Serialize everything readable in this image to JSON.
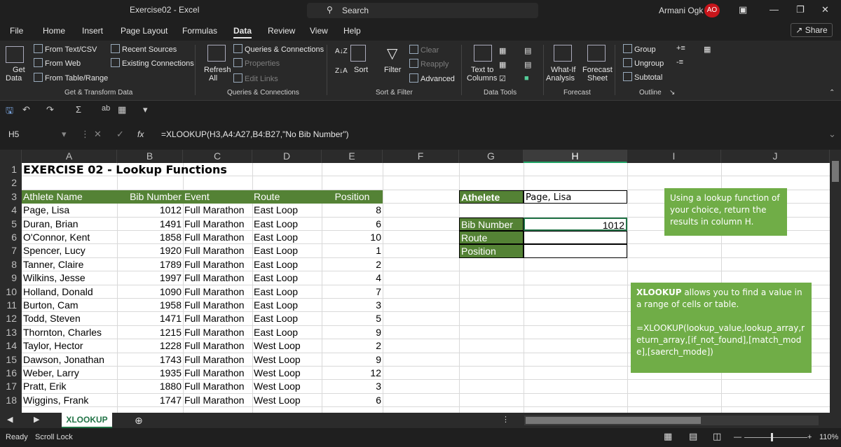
{
  "window": {
    "title": "Exercise02  -  Excel",
    "search": "Search",
    "user": "Armani Ogk",
    "initials": "AO"
  },
  "menu": [
    "File",
    "Home",
    "Insert",
    "Page Layout",
    "Formulas",
    "Data",
    "Review",
    "View",
    "Help"
  ],
  "share": "Share",
  "ribbon": {
    "get_data": "Get",
    "get_data2": "Data",
    "from_text": "From Text/CSV",
    "from_web": "From Web",
    "from_table": "From Table/Range",
    "recent": "Recent Sources",
    "existing": "Existing Connections",
    "group_get": "Get & Transform Data",
    "refresh": "Refresh",
    "refresh2": "All",
    "queries": "Queries & Connections",
    "properties": "Properties",
    "edit_links": "Edit Links",
    "group_queries": "Queries & Connections",
    "sort": "Sort",
    "filter": "Filter",
    "clear": "Clear",
    "reapply": "Reapply",
    "advanced": "Advanced",
    "group_sort": "Sort & Filter",
    "text_to": "Text to",
    "columns": "Columns",
    "group_tools": "Data Tools",
    "whatif": "What-If",
    "analysis": "Analysis",
    "forecast_sheet": "Forecast",
    "sheet": "Sheet",
    "group_forecast": "Forecast",
    "group_btn": "Group",
    "ungroup": "Ungroup",
    "subtotal": "Subtotal",
    "group_outline": "Outline"
  },
  "formula_bar": {
    "name_box": "H5",
    "fx": "fx",
    "formula": "=XLOOKUP(H3,A4:A27,B4:B27,\"No Bib Number\")"
  },
  "columns": [
    "A",
    "B",
    "C",
    "D",
    "E",
    "F",
    "G",
    "H",
    "I",
    "J"
  ],
  "selected_column": "H",
  "rows": [
    "1",
    "2",
    "3",
    "4",
    "5",
    "6",
    "7",
    "8",
    "9",
    "10",
    "11",
    "12",
    "13",
    "14",
    "15",
    "16",
    "17",
    "18"
  ],
  "sheet": {
    "title": "EXERCISE 02 - Lookup Functions",
    "headers": [
      "Athlete Name",
      "Bib Number",
      "Event",
      "Route",
      "Position"
    ],
    "data": [
      [
        "Page, Lisa",
        "1012",
        "Full Marathon",
        "East Loop",
        "8"
      ],
      [
        "Duran, Brian",
        "1491",
        "Full Marathon",
        "East Loop",
        "6"
      ],
      [
        "O'Connor, Kent",
        "1858",
        "Full Marathon",
        "East Loop",
        "10"
      ],
      [
        "Spencer, Lucy",
        "1920",
        "Full Marathon",
        "East Loop",
        "1"
      ],
      [
        "Tanner, Claire",
        "1789",
        "Full Marathon",
        "East Loop",
        "2"
      ],
      [
        "Wilkins, Jesse",
        "1997",
        "Full Marathon",
        "East Loop",
        "4"
      ],
      [
        "Holland, Donald",
        "1090",
        "Full Marathon",
        "East Loop",
        "7"
      ],
      [
        "Burton, Cam",
        "1958",
        "Full Marathon",
        "East Loop",
        "3"
      ],
      [
        "Todd, Steven",
        "1471",
        "Full Marathon",
        "East Loop",
        "5"
      ],
      [
        "Thornton, Charles",
        "1215",
        "Full Marathon",
        "East Loop",
        "9"
      ],
      [
        "Taylor, Hector",
        "1228",
        "Full Marathon",
        "West Loop",
        "2"
      ],
      [
        "Dawson, Jonathan",
        "1743",
        "Full Marathon",
        "West Loop",
        "9"
      ],
      [
        "Weber, Larry",
        "1935",
        "Full Marathon",
        "West Loop",
        "12"
      ],
      [
        "Pratt, Erik",
        "1880",
        "Full Marathon",
        "West Loop",
        "3"
      ],
      [
        "Wiggins, Frank",
        "1747",
        "Full Marathon",
        "West Loop",
        "6"
      ]
    ],
    "lookup": {
      "athlete_label": "Athelete",
      "athlete_value": "Page, Lisa",
      "bib_label": "Bib Number",
      "bib_value": "1012",
      "route_label": "Route",
      "position_label": "Position"
    },
    "note1": "Using a lookup function of your choice, return the results in column H.",
    "note2_title": "XLOOKUP",
    "note2_text": " allows you to find a value in a range of cells or table.",
    "note2_syntax": "=XLOOKUP(lookup_value,lookup_array,return_array,[if_not_found],[match_mode],[saerch_mode])"
  },
  "sheet_tab": "XLOOKUP",
  "status": {
    "ready": "Ready",
    "scroll_lock": "Scroll Lock",
    "zoom": "110%"
  }
}
